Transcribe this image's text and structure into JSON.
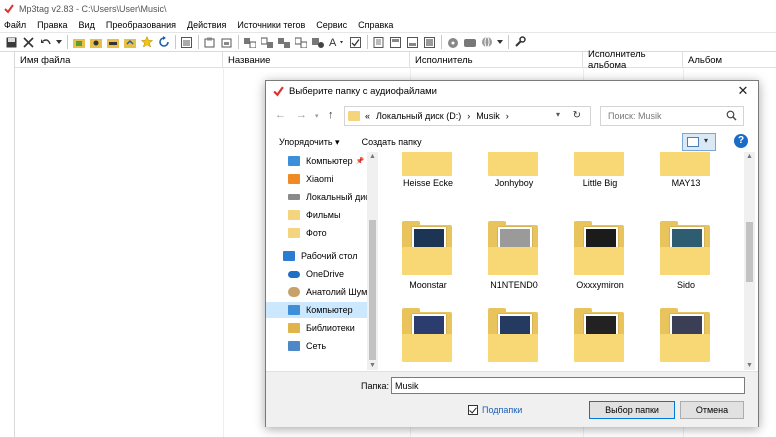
{
  "app": {
    "title": "Mp3tag v2.83  -  C:\\Users\\User\\Music\\",
    "menu": [
      "Файл",
      "Правка",
      "Вид",
      "Преобразования",
      "Действия",
      "Источники тегов",
      "Сервис",
      "Справка"
    ],
    "toolbar_icons": [
      "save-icon",
      "remove-icon",
      "undo-icon",
      "dropdown-icon",
      "add-folder-icon",
      "open-folder-icon",
      "folder-up-icon",
      "add-files-icon",
      "star-icon",
      "refresh-icon",
      "list-icon",
      "tag-copy-icon",
      "tag-paste-icon",
      "tag-to-filename-icon",
      "filename-to-tag-icon",
      "tag-to-tag-icon",
      "filename-to-filename-icon",
      "autonumber-icon",
      "case-icon",
      "check-icon",
      "doc-icon",
      "playlist-icon",
      "export-icon",
      "image-icon",
      "freedb-icon",
      "amazon-icon",
      "web-icon",
      "settings-icon"
    ],
    "columns": [
      "Имя файла",
      "Название",
      "Исполнитель",
      "Исполнитель альбома",
      "Альбом"
    ]
  },
  "dialog": {
    "title": "Выберите папку с аудиофайлами",
    "close": "✕",
    "breadcrumb": [
      "«",
      "Локальный диск (D:)",
      "›",
      "Musik",
      "›"
    ],
    "search_placeholder": "Поиск: Musik",
    "organize": "Упорядочить ▾",
    "new_folder": "Создать папку",
    "help": "?",
    "nav_items": [
      {
        "label": "Компьютер",
        "icon": "computer-icon",
        "pin": "📌"
      },
      {
        "label": "Xiaomi",
        "icon": "xiaomi-icon"
      },
      {
        "label": "Локальный дис",
        "icon": "drive-icon"
      },
      {
        "label": "Фильмы",
        "icon": "folder-icon"
      },
      {
        "label": "Фото",
        "icon": "folder-icon"
      },
      {
        "label": "Рабочий стол",
        "icon": "desktop-icon"
      },
      {
        "label": "OneDrive",
        "icon": "onedrive-icon"
      },
      {
        "label": "Анатолий Шум",
        "icon": "user-icon"
      },
      {
        "label": "Компьютер",
        "icon": "computer-icon"
      },
      {
        "label": "Библиотеки",
        "icon": "libraries-icon"
      },
      {
        "label": "Сеть",
        "icon": "network-icon"
      }
    ],
    "folders": [
      {
        "name": "Heisse Ecke",
        "cover": "#8a1d24"
      },
      {
        "name": "Jonhyboy",
        "cover": "#3b2c45"
      },
      {
        "name": "Little Big",
        "cover": "#2a1f1f"
      },
      {
        "name": "MAY13",
        "cover": "#d8d2c8"
      },
      {
        "name": "Moonstar",
        "cover": "#1d3555"
      },
      {
        "name": "N1NTEND0",
        "cover": "#9a9a9a"
      },
      {
        "name": "Oxxxymiron",
        "cover": "#1b1b1b"
      },
      {
        "name": "Sido",
        "cover": "#2e5c70"
      },
      {
        "name": "",
        "cover": "#2b3d6e"
      },
      {
        "name": "",
        "cover": "#243a60"
      },
      {
        "name": "",
        "cover": "#222222"
      },
      {
        "name": "",
        "cover": "#3a3f55"
      }
    ],
    "folder_label": "Папка:",
    "folder_value": "Musik",
    "subfolders": "Подпапки",
    "select_button": "Выбор папки",
    "cancel_button": "Отмена"
  }
}
